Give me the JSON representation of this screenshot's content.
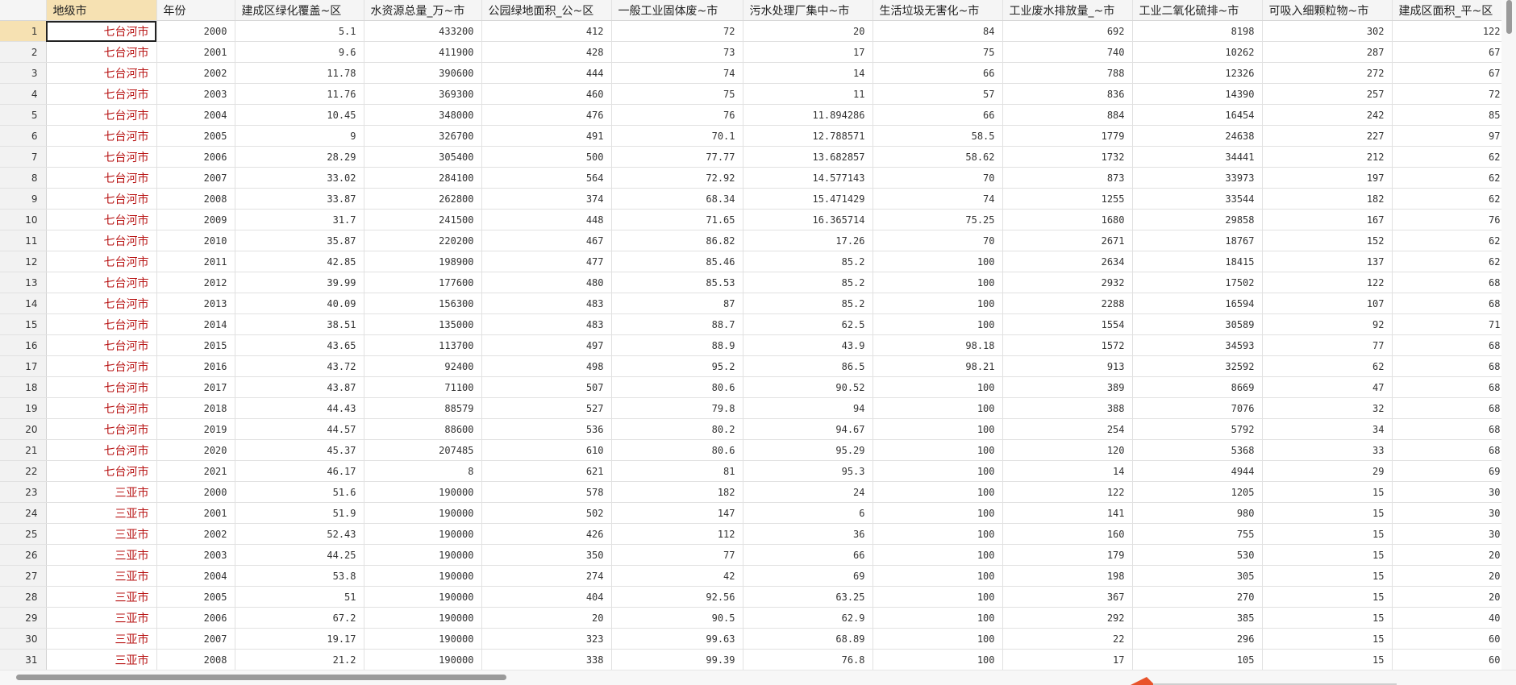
{
  "headers": [
    "地级市",
    "年份",
    "建成区绿化覆盖~区",
    "水资源总量_万~市",
    "公园绿地面积_公~区",
    "一般工业固体废~市",
    "污水处理厂集中~市",
    "生活垃圾无害化~市",
    "工业废水排放量_~市",
    "工业二氧化硫排~市",
    "可吸入细颗粒物~市",
    "建成区面积_平~区"
  ],
  "rows": [
    [
      "七台河市",
      "2000",
      "5.1",
      "433200",
      "412",
      "72",
      "20",
      "84",
      "692",
      "8198",
      "302",
      "122"
    ],
    [
      "七台河市",
      "2001",
      "9.6",
      "411900",
      "428",
      "73",
      "17",
      "75",
      "740",
      "10262",
      "287",
      "67"
    ],
    [
      "七台河市",
      "2002",
      "11.78",
      "390600",
      "444",
      "74",
      "14",
      "66",
      "788",
      "12326",
      "272",
      "67"
    ],
    [
      "七台河市",
      "2003",
      "11.76",
      "369300",
      "460",
      "75",
      "11",
      "57",
      "836",
      "14390",
      "257",
      "72"
    ],
    [
      "七台河市",
      "2004",
      "10.45",
      "348000",
      "476",
      "76",
      "11.894286",
      "66",
      "884",
      "16454",
      "242",
      "85"
    ],
    [
      "七台河市",
      "2005",
      "9",
      "326700",
      "491",
      "70.1",
      "12.788571",
      "58.5",
      "1779",
      "24638",
      "227",
      "97"
    ],
    [
      "七台河市",
      "2006",
      "28.29",
      "305400",
      "500",
      "77.77",
      "13.682857",
      "58.62",
      "1732",
      "34441",
      "212",
      "62"
    ],
    [
      "七台河市",
      "2007",
      "33.02",
      "284100",
      "564",
      "72.92",
      "14.577143",
      "70",
      "873",
      "33973",
      "197",
      "62"
    ],
    [
      "七台河市",
      "2008",
      "33.87",
      "262800",
      "374",
      "68.34",
      "15.471429",
      "74",
      "1255",
      "33544",
      "182",
      "62"
    ],
    [
      "七台河市",
      "2009",
      "31.7",
      "241500",
      "448",
      "71.65",
      "16.365714",
      "75.25",
      "1680",
      "29858",
      "167",
      "76"
    ],
    [
      "七台河市",
      "2010",
      "35.87",
      "220200",
      "467",
      "86.82",
      "17.26",
      "70",
      "2671",
      "18767",
      "152",
      "62"
    ],
    [
      "七台河市",
      "2011",
      "42.85",
      "198900",
      "477",
      "85.46",
      "85.2",
      "100",
      "2634",
      "18415",
      "137",
      "62"
    ],
    [
      "七台河市",
      "2012",
      "39.99",
      "177600",
      "480",
      "85.53",
      "85.2",
      "100",
      "2932",
      "17502",
      "122",
      "68"
    ],
    [
      "七台河市",
      "2013",
      "40.09",
      "156300",
      "483",
      "87",
      "85.2",
      "100",
      "2288",
      "16594",
      "107",
      "68"
    ],
    [
      "七台河市",
      "2014",
      "38.51",
      "135000",
      "483",
      "88.7",
      "62.5",
      "100",
      "1554",
      "30589",
      "92",
      "71"
    ],
    [
      "七台河市",
      "2015",
      "43.65",
      "113700",
      "497",
      "88.9",
      "43.9",
      "98.18",
      "1572",
      "34593",
      "77",
      "68"
    ],
    [
      "七台河市",
      "2016",
      "43.72",
      "92400",
      "498",
      "95.2",
      "86.5",
      "98.21",
      "913",
      "32592",
      "62",
      "68"
    ],
    [
      "七台河市",
      "2017",
      "43.87",
      "71100",
      "507",
      "80.6",
      "90.52",
      "100",
      "389",
      "8669",
      "47",
      "68"
    ],
    [
      "七台河市",
      "2018",
      "44.43",
      "88579",
      "527",
      "79.8",
      "94",
      "100",
      "388",
      "7076",
      "32",
      "68"
    ],
    [
      "七台河市",
      "2019",
      "44.57",
      "88600",
      "536",
      "80.2",
      "94.67",
      "100",
      "254",
      "5792",
      "34",
      "68"
    ],
    [
      "七台河市",
      "2020",
      "45.37",
      "207485",
      "610",
      "80.6",
      "95.29",
      "100",
      "120",
      "5368",
      "33",
      "68"
    ],
    [
      "七台河市",
      "2021",
      "46.17",
      "8",
      "621",
      "81",
      "95.3",
      "100",
      "14",
      "4944",
      "29",
      "69"
    ],
    [
      "三亚市",
      "2000",
      "51.6",
      "190000",
      "578",
      "182",
      "24",
      "100",
      "122",
      "1205",
      "15",
      "30"
    ],
    [
      "三亚市",
      "2001",
      "51.9",
      "190000",
      "502",
      "147",
      "6",
      "100",
      "141",
      "980",
      "15",
      "30"
    ],
    [
      "三亚市",
      "2002",
      "52.43",
      "190000",
      "426",
      "112",
      "36",
      "100",
      "160",
      "755",
      "15",
      "30"
    ],
    [
      "三亚市",
      "2003",
      "44.25",
      "190000",
      "350",
      "77",
      "66",
      "100",
      "179",
      "530",
      "15",
      "20"
    ],
    [
      "三亚市",
      "2004",
      "53.8",
      "190000",
      "274",
      "42",
      "69",
      "100",
      "198",
      "305",
      "15",
      "20"
    ],
    [
      "三亚市",
      "2005",
      "51",
      "190000",
      "404",
      "92.56",
      "63.25",
      "100",
      "367",
      "270",
      "15",
      "20"
    ],
    [
      "三亚市",
      "2006",
      "67.2",
      "190000",
      "20",
      "90.5",
      "62.9",
      "100",
      "292",
      "385",
      "15",
      "40"
    ],
    [
      "三亚市",
      "2007",
      "19.17",
      "190000",
      "323",
      "99.63",
      "68.89",
      "100",
      "22",
      "296",
      "15",
      "60"
    ],
    [
      "三亚市",
      "2008",
      "21.2",
      "190000",
      "338",
      "99.39",
      "76.8",
      "100",
      "17",
      "105",
      "15",
      "60"
    ]
  ],
  "colors": {
    "accent_row_col": "#f6e1b2",
    "city_text": "#b81414"
  }
}
